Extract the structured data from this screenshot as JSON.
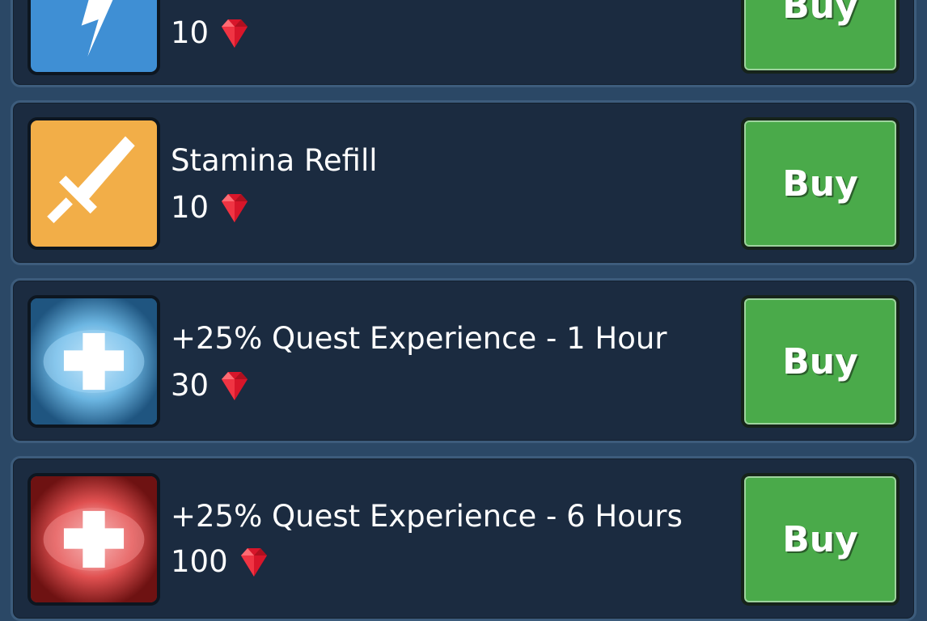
{
  "items": [
    {
      "name": "",
      "price": "10",
      "icon": "lightning-bolt-icon",
      "color": "#3f8fd4",
      "buy_label": "Buy"
    },
    {
      "name": "Stamina Refill",
      "price": "10",
      "icon": "sword-icon",
      "color": "#f2ae48",
      "buy_label": "Buy"
    },
    {
      "name": "+25% Quest Experience - 1 Hour",
      "price": "30",
      "icon": "blue-cross-icon",
      "color": "#2d6a99",
      "buy_label": "Buy"
    },
    {
      "name": "+25% Quest Experience - 6 Hours",
      "price": "100",
      "icon": "red-cross-icon",
      "color": "#a42a2a",
      "buy_label": "Buy"
    }
  ],
  "currency_icon": "ruby-gem-icon",
  "colors": {
    "background": "#2b4866",
    "row": "#1b2b40",
    "buy": "#4aaa4a"
  }
}
